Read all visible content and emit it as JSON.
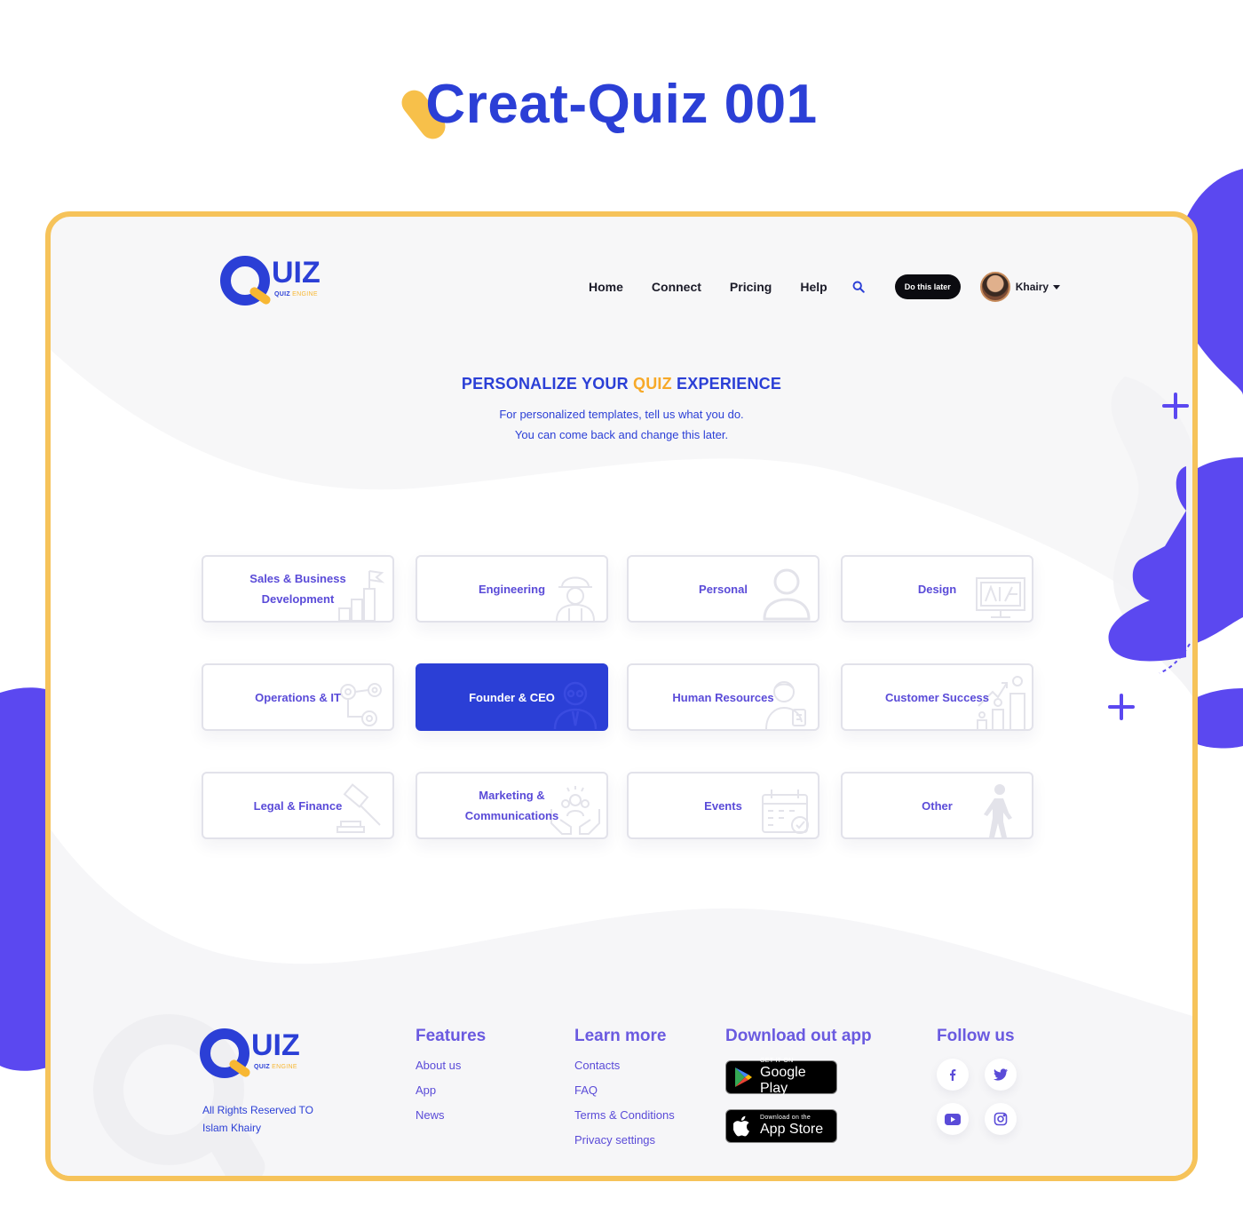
{
  "page": {
    "heading": "Creat-Quiz 001"
  },
  "header": {
    "logo_text": "UIZ",
    "logo_sub_a": "QUIZ",
    "logo_sub_b": "ENGINE",
    "nav": [
      "Home",
      "Connect",
      "Pricing",
      "Help"
    ],
    "later_button": "Do this later",
    "user_name": "Khairy"
  },
  "hero": {
    "title_a": "PERSONALIZE YOUR ",
    "title_accent": "QUIZ",
    "title_b": " EXPERIENCE",
    "subtitle_1": "For personalized templates, tell us what you do.",
    "subtitle_2": "You can come back and change this later."
  },
  "categories": [
    {
      "label": "Sales & Business\nDevelopment",
      "icon": "chart-flag-icon",
      "selected": false
    },
    {
      "label": "Engineering",
      "icon": "engineer-icon",
      "selected": false
    },
    {
      "label": "Personal",
      "icon": "person-icon",
      "selected": false
    },
    {
      "label": "Design",
      "icon": "design-monitor-icon",
      "selected": false
    },
    {
      "label": "Operations & IT",
      "icon": "gears-icon",
      "selected": false
    },
    {
      "label": "Founder & CEO",
      "icon": "founder-icon",
      "selected": true
    },
    {
      "label": "Human Resources",
      "icon": "hr-person-icon",
      "selected": false
    },
    {
      "label": "Customer Success",
      "icon": "customer-growth-icon",
      "selected": false
    },
    {
      "label": "Legal & Finance",
      "icon": "gavel-icon",
      "selected": false
    },
    {
      "label": "Marketing &\nCommunications",
      "icon": "team-hands-icon",
      "selected": false
    },
    {
      "label": "Events",
      "icon": "calendar-icon",
      "selected": false
    },
    {
      "label": "Other",
      "icon": "walking-person-icon",
      "selected": false
    }
  ],
  "footer": {
    "copyright": "All Rights Reserved TO\nIslam Khairy",
    "features": {
      "title": "Features",
      "links": [
        "About us",
        "App",
        "News"
      ]
    },
    "learn": {
      "title": "Learn more",
      "links": [
        "Contacts",
        "FAQ",
        "Terms & Conditions",
        "Privacy settings"
      ]
    },
    "download": {
      "title": "Download out app",
      "google_small": "GET IT ON",
      "google_big": "Google Play",
      "apple_small": "Download on the",
      "apple_big": "App Store"
    },
    "follow": {
      "title": "Follow us",
      "icons": [
        "facebook-icon",
        "twitter-icon",
        "youtube-icon",
        "instagram-icon"
      ]
    }
  },
  "colors": {
    "primary": "#2b3fd6",
    "accent": "#f7a928",
    "frame": "#f6c35a",
    "purple": "#5a4bd8"
  }
}
